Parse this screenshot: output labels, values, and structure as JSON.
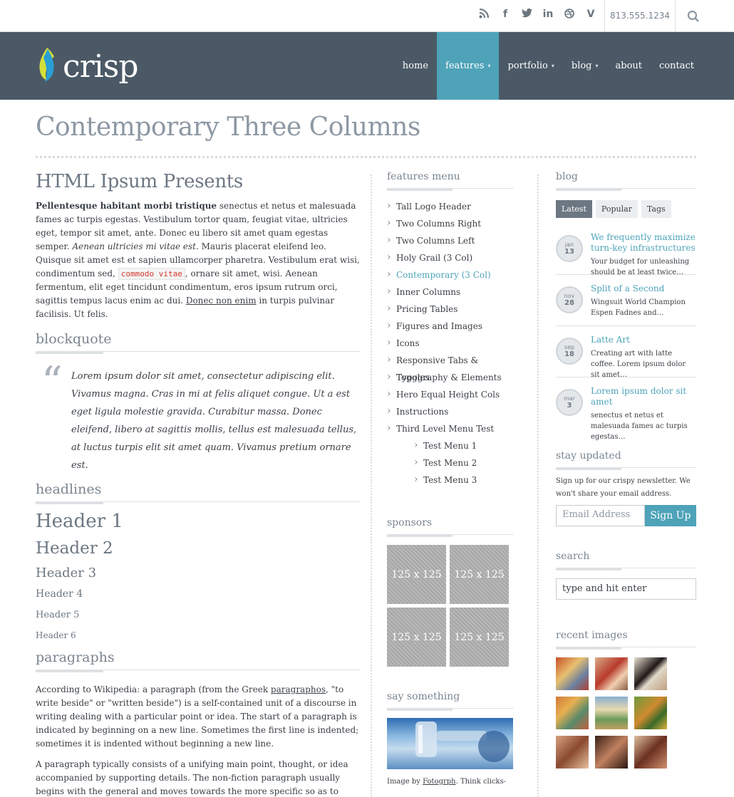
{
  "topbar": {
    "phone": "813.555.1234",
    "social": [
      "rss-icon",
      "facebook-icon",
      "twitter-icon",
      "linkedin-icon",
      "dribbble-icon",
      "vimeo-icon"
    ]
  },
  "brand": {
    "name": "crisp"
  },
  "nav": {
    "items": [
      {
        "label": "home"
      },
      {
        "label": "features"
      },
      {
        "label": "portfolio"
      },
      {
        "label": "blog"
      },
      {
        "label": "about"
      },
      {
        "label": "contact"
      }
    ]
  },
  "page": {
    "title": "Contemporary Three Columns"
  },
  "main": {
    "heading": "HTML Ipsum Presents",
    "intro": {
      "bold": "Pellentesque habitant morbi tristique",
      "t1": " senectus et netus et malesuada fames ac turpis egestas. Vestibulum tortor quam, feugiat vitae, ultricies eget, tempor sit amet, ante. Donec eu libero sit amet quam egestas semper. ",
      "italic": "Aenean ultricies mi vitae est.",
      "t2": " Mauris placerat eleifend leo. Quisque sit amet est et sapien ullamcorper pharetra. Vestibulum erat wisi, condimentum sed, ",
      "code": "commodo vitae",
      "t3": ", ornare sit amet, wisi. Aenean fermentum, elit eget tincidunt condimentum, eros ipsum rutrum orci, sagittis tempus lacus enim ac dui. ",
      "link": "Donec non enim",
      "t4": " in turpis pulvinar facilisis. Ut felis."
    },
    "blockquote_title": "blockquote",
    "blockquote": "Lorem ipsum dolor sit amet, consectetur adipiscing elit. Vivamus magna. Cras in mi at felis aliquet congue. Ut a est eget ligula molestie gravida. Curabitur massa. Donec eleifend, libero at sagittis mollis, tellus est malesuada tellus, at luctus turpis elit sit amet quam. Vivamus pretium ornare est.",
    "headlines_title": "headlines",
    "headers": [
      "Header 1",
      "Header 2",
      "Header 3",
      "Header 4",
      "Header 5",
      "Header 6"
    ],
    "paragraphs_title": "paragraphs",
    "p1a": "According to Wikipedia: a paragraph (from the Greek ",
    "p1link": "paragraphos",
    "p1b": ", \"to write beside\" or \"written beside\") is a self-contained unit of a discourse in writing dealing with a particular point or idea. The start of a paragraph is indicated by beginning on a new line. Sometimes the first line is indented; sometimes it is indented without beginning a new line.",
    "p2": "A paragraph typically consists of a unifying main point, thought, or idea accompanied by supporting details. The non-fiction paragraph usually begins with the general and moves towards the more specific so as to advance an argument or point of view. Each paragraph builds on what came before and lays the ground or"
  },
  "features": {
    "title": "features menu",
    "items": [
      "Tall Logo Header",
      "Two Columns Right",
      "Two Columns Left",
      "Holy Grail (3 Col)",
      "Contemporary (3 Col)",
      "Inner Columns",
      "Pricing Tables",
      "Figures and Images",
      "Icons",
      "Responsive Tabs & Toggles",
      "Typography & Elements",
      "Hero Equal Height Cols",
      "Instructions",
      "Third Level Menu Test"
    ],
    "subitems": [
      "Test Menu 1",
      "Test Menu 2",
      "Test Menu 3"
    ]
  },
  "sponsors": {
    "title": "sponsors",
    "ads": [
      "125 x 125",
      "125 x 125",
      "125 x 125",
      "125 x 125"
    ]
  },
  "say": {
    "title": "say something",
    "caption_a": "Image by ",
    "caption_link": "Fotogrph",
    "caption_b": ". Think clicks-"
  },
  "blog": {
    "title": "blog",
    "tabs": [
      "Latest",
      "Popular",
      "Tags"
    ],
    "posts": [
      {
        "m": "jan",
        "d": "13",
        "title": "We frequently maximize turn-key infrastructures",
        "excerpt": "Your budget for unleashing should be at least twice…"
      },
      {
        "m": "nov",
        "d": "28",
        "title": "Split of a Second",
        "excerpt": "Wingsuit World Champion Espen Fadnes and…"
      },
      {
        "m": "sep",
        "d": "18",
        "title": "Latte Art",
        "excerpt": "Creating art with latte coffee. Lorem ipsum dolor sit amet…"
      },
      {
        "m": "mar",
        "d": "3",
        "title": "Lorem ipsum dolor sit amet",
        "excerpt": "senectus et netus et malesuada fames ac turpis egestas…"
      }
    ]
  },
  "newsletter": {
    "title": "stay updated",
    "text": "Sign up for our crispy newsletter. We won't share your email address.",
    "placeholder": "Email Address",
    "button": "Sign Up"
  },
  "search": {
    "title": "search",
    "placeholder": "type and hit enter"
  },
  "recent": {
    "title": "recent images"
  },
  "colors": {
    "accent": "#4ea3b9",
    "header_bg": "#4b5966"
  }
}
